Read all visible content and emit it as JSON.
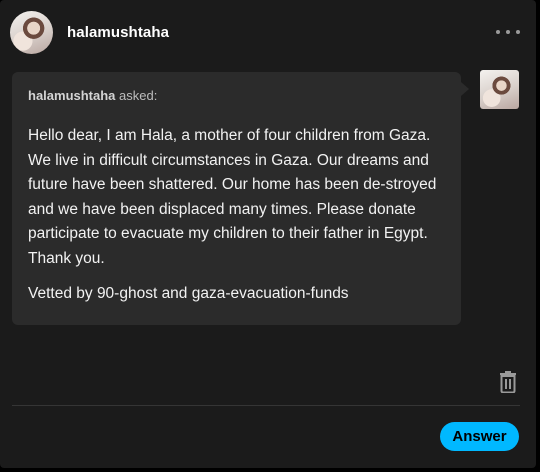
{
  "post": {
    "username": "halamushtaha",
    "menu_icon": "more-horizontal-icon"
  },
  "ask": {
    "asker": "halamushtaha",
    "asked_label": "asked:",
    "body": "Hello dear, I am Hala, a mother of four children from Gaza. We live in difficult circumstances in Gaza. Our dreams and future have been shattered. Our home has been de-stroyed and we have been displaced many times. Please donate participate to evacuate my children to their father in Egypt. Thank you.",
    "vetted": "Vetted by 90-ghost and gaza-evacuation-funds"
  },
  "actions": {
    "delete_icon": "trash-icon",
    "answer_label": "Answer"
  },
  "colors": {
    "background": "#000000",
    "card": "#1b1b1b",
    "bubble": "#2b2b2b",
    "accent": "#00b8ff"
  }
}
